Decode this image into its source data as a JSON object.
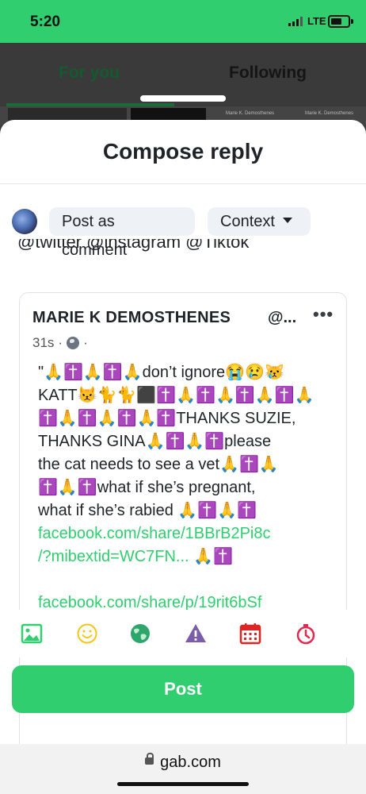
{
  "status_bar": {
    "time": "5:20",
    "network": "LTE",
    "battery_level": 0.6
  },
  "background_app": {
    "tabs": [
      {
        "label": "For you",
        "active": true
      },
      {
        "label": "Following",
        "active": false
      }
    ],
    "strip_labels": [
      "Marie K. Demosthenes",
      "Marie K. Demosthenes"
    ]
  },
  "compose": {
    "title": "Compose reply",
    "post_as_label": "Post as comment",
    "context_label": "Context",
    "reply_text": "@twitter @instagram @Tiktok"
  },
  "quoted_post": {
    "author": "MARIE K DEMOSTHENES",
    "handle": "@...",
    "more": "•••",
    "time": "31s",
    "body_lines": [
      "\"🙏✝️🙏✝️🙏don’t ignore😭😢😿",
      "KATT😾🐈🐈⬛✝️🙏✝️🙏✝️🙏✝️🙏",
      "✝️🙏✝️🙏✝️🙏✝️THANKS SUZIE,",
      "THANKS GINA🙏✝️🙏✝️please",
      "the cat needs to see a vet🙏✝️🙏",
      "✝️🙏✝️what if she’s pregnant,",
      "what if she’s rabied 🙏✝️🙏✝️"
    ],
    "link1_line1": "facebook.com/share/1BBrB2Pi8c",
    "link1_line2": "/?mibextid=WC7FN...",
    "link1_suffix": " 🙏✝️",
    "link2": "facebook.com/share/p/19rit6bSf"
  },
  "toolbar": {
    "icons": [
      "image-icon",
      "emoji-icon",
      "globe-icon",
      "warning-icon",
      "calendar-icon",
      "timer-icon"
    ],
    "colors": {
      "image": "#30ce6f",
      "emoji": "#f5c518",
      "globe": "#2ea56a",
      "warning": "#7b5ea7",
      "calendar": "#e02424",
      "timer": "#e5284d"
    }
  },
  "post_button": {
    "label": "Post",
    "color": "#30ce6f"
  },
  "browser": {
    "url": "gab.com"
  },
  "colors": {
    "brand_green": "#30ce6f",
    "text_dark": "#1f2328"
  }
}
